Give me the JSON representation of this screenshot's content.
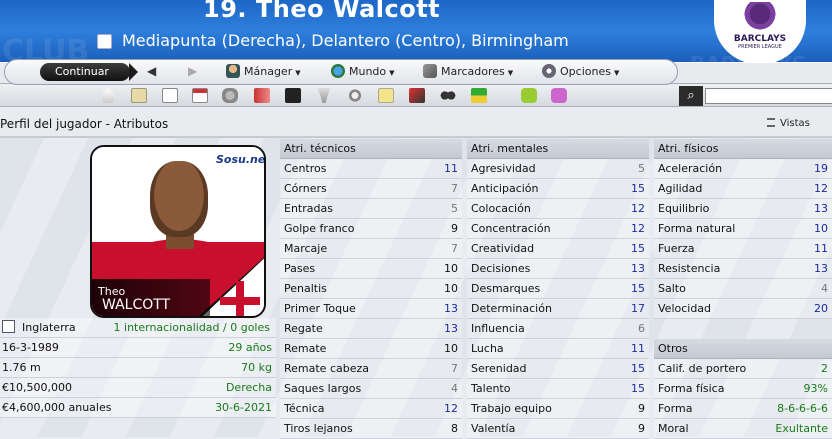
{
  "header": {
    "title": "19. Theo Walcott",
    "subtitle": "Mediapunta (Derecha), Delantero (Centro), Birmingham",
    "bg_texts": [
      "CLUB",
      "BARCLAYS"
    ],
    "league_logo": {
      "line1": "BARCLAYS",
      "line2": "PREMIER LEAGUE"
    }
  },
  "menu": {
    "continue_label": "Continuar",
    "items": [
      {
        "label": "Mánager"
      },
      {
        "label": "Mundo"
      },
      {
        "label": "Marcadores"
      },
      {
        "label": "Opciones"
      }
    ]
  },
  "page": {
    "title": "Perfil del jugador - Atributos",
    "views_label": "Vistas"
  },
  "photo": {
    "first_name": "Theo",
    "last_name": "WALCOTT",
    "watermark": "Sosu.net"
  },
  "info": [
    {
      "left": "Inglaterra",
      "right": "1 internacionalidad / 0 goles"
    },
    {
      "left": "16-3-1989",
      "right": "29 años"
    },
    {
      "left": "1.76 m",
      "right": "70 kg"
    },
    {
      "left": "€10,500,000",
      "right": "Derecha"
    },
    {
      "left": "€4,600,000 anuales",
      "right": "30-6-2021"
    }
  ],
  "technical": {
    "title": "Atri. técnicos",
    "rows": [
      {
        "name": "Centros",
        "value": "11",
        "color": "b"
      },
      {
        "name": "Córners",
        "value": "7",
        "color": "g"
      },
      {
        "name": "Entradas",
        "value": "5",
        "color": "g"
      },
      {
        "name": "Golpe franco",
        "value": "9",
        "color": "k"
      },
      {
        "name": "Marcaje",
        "value": "7",
        "color": "g"
      },
      {
        "name": "Pases",
        "value": "10",
        "color": "k"
      },
      {
        "name": "Penaltis",
        "value": "10",
        "color": "k"
      },
      {
        "name": "Primer Toque",
        "value": "13",
        "color": "b"
      },
      {
        "name": "Regate",
        "value": "13",
        "color": "b"
      },
      {
        "name": "Remate",
        "value": "10",
        "color": "k"
      },
      {
        "name": "Remate cabeza",
        "value": "7",
        "color": "g"
      },
      {
        "name": "Saques largos",
        "value": "4",
        "color": "g"
      },
      {
        "name": "Técnica",
        "value": "12",
        "color": "b"
      },
      {
        "name": "Tiros lejanos",
        "value": "8",
        "color": "k"
      }
    ]
  },
  "mental": {
    "title": "Atri. mentales",
    "rows": [
      {
        "name": "Agresividad",
        "value": "5",
        "color": "g"
      },
      {
        "name": "Anticipación",
        "value": "15",
        "color": "b"
      },
      {
        "name": "Colocación",
        "value": "12",
        "color": "b"
      },
      {
        "name": "Concentración",
        "value": "12",
        "color": "b"
      },
      {
        "name": "Creatividad",
        "value": "15",
        "color": "b"
      },
      {
        "name": "Decisiones",
        "value": "13",
        "color": "b"
      },
      {
        "name": "Desmarques",
        "value": "15",
        "color": "b"
      },
      {
        "name": "Determinación",
        "value": "17",
        "color": "b"
      },
      {
        "name": "Influencia",
        "value": "6",
        "color": "g"
      },
      {
        "name": "Lucha",
        "value": "11",
        "color": "b"
      },
      {
        "name": "Serenidad",
        "value": "15",
        "color": "b"
      },
      {
        "name": "Talento",
        "value": "15",
        "color": "b"
      },
      {
        "name": "Trabajo equipo",
        "value": "9",
        "color": "k"
      },
      {
        "name": "Valentía",
        "value": "9",
        "color": "k"
      }
    ]
  },
  "physical": {
    "title": "Atri. físicos",
    "rows": [
      {
        "name": "Aceleración",
        "value": "19",
        "color": "b"
      },
      {
        "name": "Agilidad",
        "value": "12",
        "color": "b"
      },
      {
        "name": "Equilibrio",
        "value": "13",
        "color": "b"
      },
      {
        "name": "Forma natural",
        "value": "10",
        "color": "b"
      },
      {
        "name": "Fuerza",
        "value": "11",
        "color": "b"
      },
      {
        "name": "Resistencia",
        "value": "13",
        "color": "b"
      },
      {
        "name": "Salto",
        "value": "4",
        "color": "g"
      },
      {
        "name": "Velocidad",
        "value": "20",
        "color": "b"
      }
    ]
  },
  "other": {
    "title": "Otros",
    "rows": [
      {
        "name": "Calif. de portero",
        "value": "2"
      },
      {
        "name": "Forma física",
        "value": "93%"
      },
      {
        "name": "Forma",
        "value": "8-6-6-6-6"
      },
      {
        "name": "Moral",
        "value": "Exultante"
      }
    ]
  }
}
